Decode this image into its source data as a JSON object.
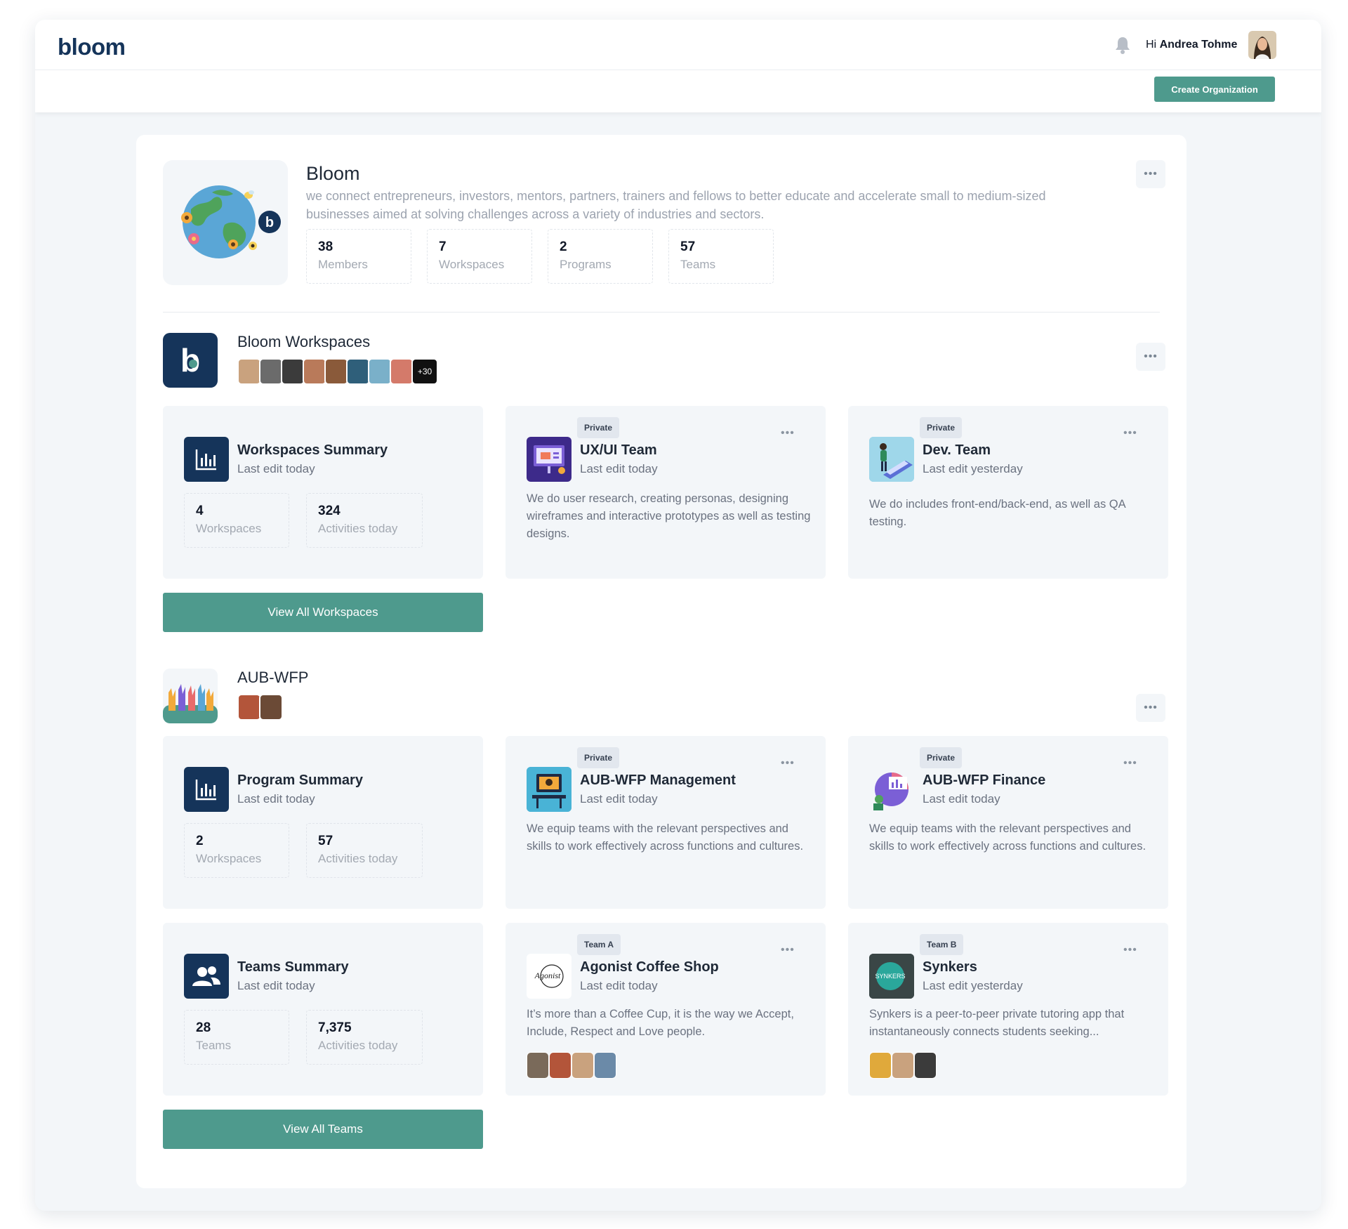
{
  "app": {
    "logo_text": "bloom"
  },
  "header": {
    "greeting": "Hi",
    "user_name": "Andrea Tohme",
    "create_label": "Create Organization"
  },
  "org": {
    "name": "Bloom",
    "description": "we connect entrepreneurs, investors, mentors, partners, trainers and fellows to better educate and accelerate small to medium-sized businesses aimed at solving challenges across a variety of industries and sectors.",
    "stats": [
      {
        "num": "38",
        "label": "Members"
      },
      {
        "num": "7",
        "label": "Workspaces"
      },
      {
        "num": "2",
        "label": "Programs"
      },
      {
        "num": "57",
        "label": "Teams"
      }
    ]
  },
  "workspaces_section": {
    "title": "Bloom Workspaces",
    "more_count": "+30",
    "summary": {
      "title": "Workspaces Summary",
      "sub": "Last edit today",
      "stats": [
        {
          "num": "4",
          "label": "Workspaces"
        },
        {
          "num": "324",
          "label": "Activities today"
        }
      ]
    },
    "cards": [
      {
        "badge": "Private",
        "title": "UX/UI Team",
        "sub": "Last edit today",
        "desc": "We do user research, creating personas, designing wireframes and interactive prototypes as well as testing designs."
      },
      {
        "badge": "Private",
        "title": "Dev. Team",
        "sub": "Last edit yesterday",
        "desc": "We do includes front-end/back-end, as well as QA testing."
      }
    ],
    "button": "View All Workspaces"
  },
  "aub_section": {
    "title": "AUB-WFP",
    "program_summary": {
      "title": "Program Summary",
      "sub": "Last edit today",
      "stats": [
        {
          "num": "2",
          "label": "Workspaces"
        },
        {
          "num": "57",
          "label": "Activities today"
        }
      ]
    },
    "cards": [
      {
        "badge": "Private",
        "title": "AUB-WFP Management",
        "sub": "Last edit today",
        "desc": "We equip teams with the relevant perspectives and skills to work effectively across functions and cultures."
      },
      {
        "badge": "Private",
        "title": "AUB-WFP Finance",
        "sub": "Last edit today",
        "desc": "We equip teams with the relevant perspectives and skills to work effectively across functions and cultures."
      }
    ],
    "teams_summary": {
      "title": "Teams Summary",
      "sub": "Last edit today",
      "stats": [
        {
          "num": "28",
          "label": "Teams"
        },
        {
          "num": "7,375",
          "label": "Activities today"
        }
      ]
    },
    "team_cards": [
      {
        "badge": "Team A",
        "title": "Agonist Coffee Shop",
        "sub": "Last edit today",
        "desc": "It’s more than a Coffee Cup, it is the way we Accept, Include, Respect and Love people.",
        "logo_text": "Agonist"
      },
      {
        "badge": "Team B",
        "title": "Synkers",
        "sub": "Last edit yesterday",
        "desc": "Synkers is a peer-to-peer private tutoring app that instantaneously connects students seeking...",
        "logo_text": "SYNKERS"
      }
    ],
    "button": "View All Teams"
  },
  "colors": {
    "accent": "#4e9a8d",
    "navy": "#15345a",
    "card_bg": "#f3f6f9"
  }
}
